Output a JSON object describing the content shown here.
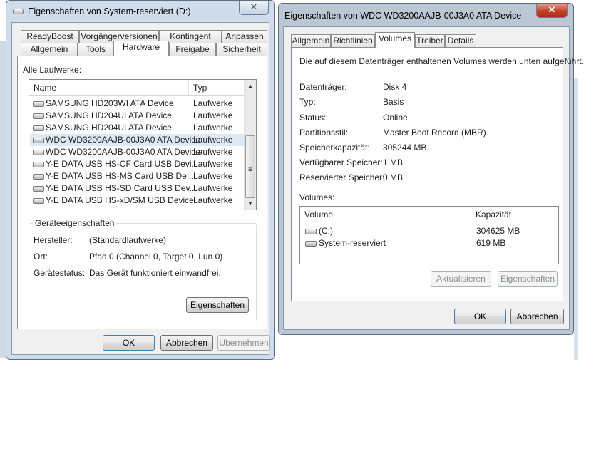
{
  "colors": {
    "titlebar_left": "#cfdceb",
    "titlebar_right": "#bcc7d4",
    "close_red": "#c44028"
  },
  "window_left": {
    "title": "Eigenschaften von System-reserviert (D:)",
    "close": "✕",
    "tabs_back": [
      "ReadyBoost",
      "Vorgängerversionen",
      "Kontingent",
      "Anpassen"
    ],
    "tabs_front": [
      "Allgemein",
      "Tools",
      "Hardware",
      "Freigabe",
      "Sicherheit"
    ],
    "selected_tab": "Hardware",
    "all_drives_label": "Alle Laufwerke:",
    "columns": [
      "Name",
      "Typ"
    ],
    "drives": [
      {
        "name": "SAMSUNG HD203WI ATA Device",
        "type": "Laufwerke"
      },
      {
        "name": "SAMSUNG HD204UI ATA Device",
        "type": "Laufwerke"
      },
      {
        "name": "SAMSUNG HD204UI ATA Device",
        "type": "Laufwerke"
      },
      {
        "name": "WDC WD3200AAJB-00J3A0 ATA Device",
        "type": "Laufwerke"
      },
      {
        "name": "WDC WD3200AAJB-00J3A0 ATA Device",
        "type": "Laufwerke"
      },
      {
        "name": "Y-E DATA USB    HS-CF Card USB Devi...",
        "type": "Laufwerke"
      },
      {
        "name": "Y-E DATA USB    HS-MS Card USB De...",
        "type": "Laufwerke"
      },
      {
        "name": "Y-E DATA USB    HS-SD Card USB Dev...",
        "type": "Laufwerke"
      },
      {
        "name": "Y-E DATA USB    HS-xD/SM USB Device",
        "type": "Laufwerke"
      }
    ],
    "device_props": {
      "title": "Geräteeigenschaften",
      "manufacturer_label": "Hersteller:",
      "manufacturer": "(Standardlaufwerke)",
      "location_label": "Ort:",
      "location": "Pfad 0 (Channel 0, Target 0, Lun 0)",
      "status_label": "Gerätestatus:",
      "status": "Das Gerät funktioniert einwandfrei.",
      "properties_button": "Eigenschaften"
    },
    "ok": "OK",
    "cancel": "Abbrechen",
    "apply": "Übernehmen"
  },
  "window_right": {
    "title": "Eigenschaften von WDC WD3200AAJB-00J3A0 ATA Device",
    "close": "✕",
    "tabs": [
      "Allgemein",
      "Richtlinien",
      "Volumes",
      "Treiber",
      "Details"
    ],
    "selected_tab": "Volumes",
    "description": "Die auf diesem Datenträger enthaltenen Volumes werden unten aufgeführt.",
    "fields": [
      {
        "label": "Datenträger:",
        "value": "Disk 4"
      },
      {
        "label": "Typ:",
        "value": "Basis"
      },
      {
        "label": "Status:",
        "value": "Online"
      },
      {
        "label": "Partitionsstil:",
        "value": "Master Boot Record (MBR)"
      },
      {
        "label": "Speicherkapazität:",
        "value": "305244 MB"
      },
      {
        "label": "Verfügbarer Speicher:",
        "value": "1 MB"
      },
      {
        "label": "Reservierter Speicher:",
        "value": "0 MB"
      }
    ],
    "volumes_label": "Volumes:",
    "volume_columns": [
      "Volume",
      "Kapazität"
    ],
    "volumes": [
      {
        "name": "(C:)",
        "capacity": "304625 MB"
      },
      {
        "name": "System-reserviert",
        "capacity": "619 MB"
      }
    ],
    "refresh_button": "Aktualisieren",
    "properties_button": "Eigenschaften",
    "ok": "OK",
    "cancel": "Abbrechen"
  }
}
